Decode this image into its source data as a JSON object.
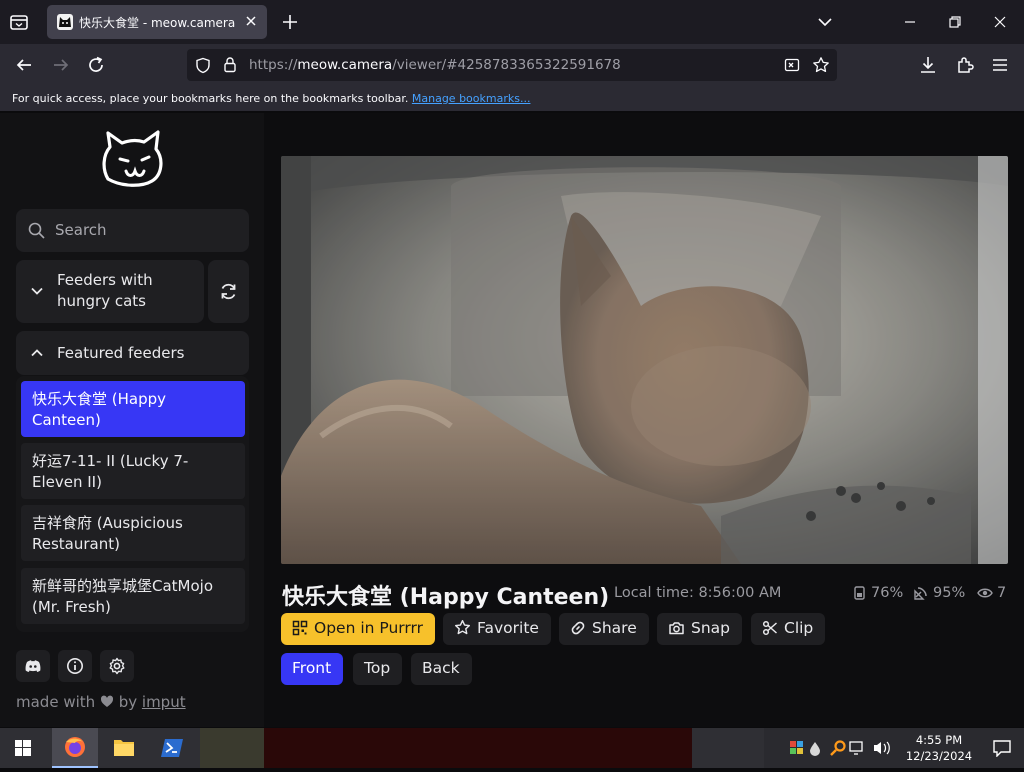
{
  "browser": {
    "tab_title": "快乐大食堂 - meow.camera",
    "url_prefix": "https://",
    "url_host": "meow.camera",
    "url_path": "/viewer/#4258783365322591678",
    "bookmarks_text": "For quick access, place your bookmarks here on the bookmarks toolbar.",
    "bookmarks_link": "Manage bookmarks..."
  },
  "sidebar": {
    "search_placeholder": "Search",
    "group_hungry": {
      "line1": "Feeders with",
      "line2": "hungry cats"
    },
    "group_featured": "Featured feeders",
    "feeders": [
      {
        "line1": "快乐大食堂 (Happy",
        "line2": "Canteen)",
        "active": true
      },
      {
        "line1": "好运7-11- II  (Lucky 7-",
        "line2": "Eleven II)",
        "active": false
      },
      {
        "line1": "吉祥食府 (Auspicious",
        "line2": "Restaurant)",
        "active": false
      },
      {
        "line1": "新鲜哥的独享城堡CatMojo",
        "line2": "(Mr. Fresh)",
        "active": false
      }
    ],
    "made_with": "made with",
    "by": "by",
    "author": "imput"
  },
  "camera": {
    "title": "快乐大食堂 (Happy Canteen)",
    "local_time": "Local time: 8:56:00 AM",
    "food_level": "76%",
    "signal": "95%",
    "viewers": "7"
  },
  "actions": {
    "open": "Open in Purrrr",
    "favorite": "Favorite",
    "share": "Share",
    "snap": "Snap",
    "clip": "Clip"
  },
  "views": {
    "front": "Front",
    "top": "Top",
    "back": "Back",
    "selected": "Front"
  },
  "taskbar": {
    "time": "4:55 PM",
    "date": "12/23/2024"
  },
  "colors": {
    "accent_blue": "#3737f5",
    "accent_yellow": "#f7c12b"
  }
}
